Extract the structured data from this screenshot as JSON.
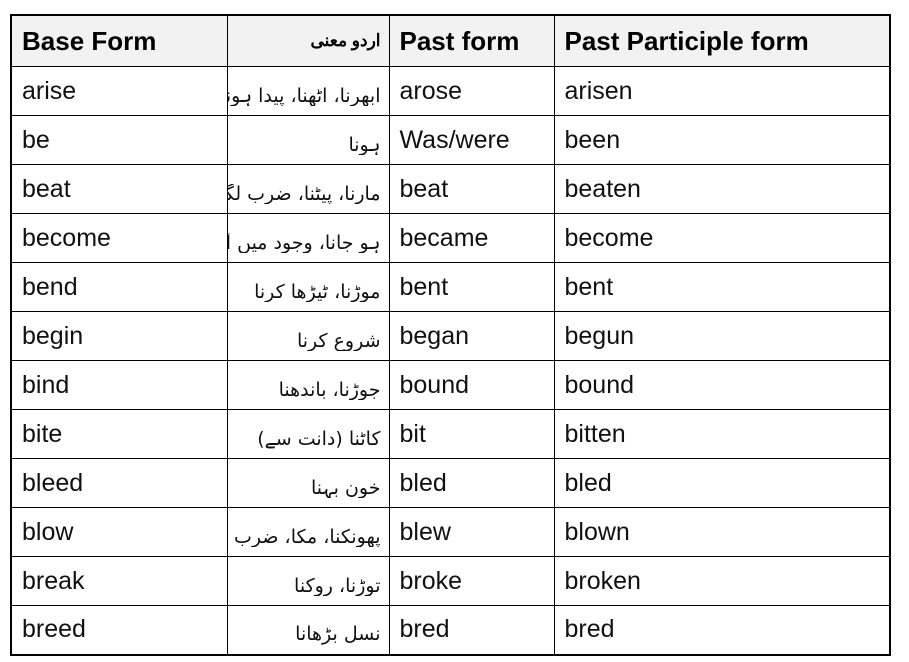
{
  "table": {
    "columns": [
      {
        "key": "base",
        "label": "Base Form",
        "lang": "en"
      },
      {
        "key": "urdu",
        "label": "اردو معنی",
        "lang": "ur"
      },
      {
        "key": "past",
        "label": "Past form",
        "lang": "en"
      },
      {
        "key": "participle",
        "label": "Past Participle form",
        "lang": "en"
      }
    ],
    "header_background": "#f2f2f2",
    "border_color": "#000000",
    "rows": [
      {
        "base": "arise",
        "urdu": "ابھرنا، اٹھنا، پیدا ہونا",
        "past": "arose",
        "participle": "arisen"
      },
      {
        "base": "be",
        "urdu": "ہونا",
        "past": "Was/were",
        "participle": "been"
      },
      {
        "base": "beat",
        "urdu": "مارنا، پیٹنا، ضرب لگانا",
        "past": "beat",
        "participle": "beaten"
      },
      {
        "base": "become",
        "urdu": "ہو جانا، وجود میں آنا",
        "past": "became",
        "participle": "become"
      },
      {
        "base": "bend",
        "urdu": "موڑنا، ٹیڑھا کرنا",
        "past": "bent",
        "participle": "bent"
      },
      {
        "base": "begin",
        "urdu": "شروع کرنا",
        "past": "began",
        "participle": "begun"
      },
      {
        "base": "bind",
        "urdu": "جوڑنا، باندھنا",
        "past": "bound",
        "participle": "bound"
      },
      {
        "base": "bite",
        "urdu": "کاٹنا (دانت سے)",
        "past": "bit",
        "participle": "bitten"
      },
      {
        "base": "bleed",
        "urdu": "خون بہنا",
        "past": "bled",
        "participle": "bled"
      },
      {
        "base": "blow",
        "urdu": "پھونکنا، مکا، ضرب",
        "past": "blew",
        "participle": "blown"
      },
      {
        "base": "break",
        "urdu": "توڑنا، روکنا",
        "past": "broke",
        "participle": "broken"
      },
      {
        "base": "breed",
        "urdu": "نسل بڑھانا",
        "past": "bred",
        "participle": "bred"
      }
    ]
  }
}
